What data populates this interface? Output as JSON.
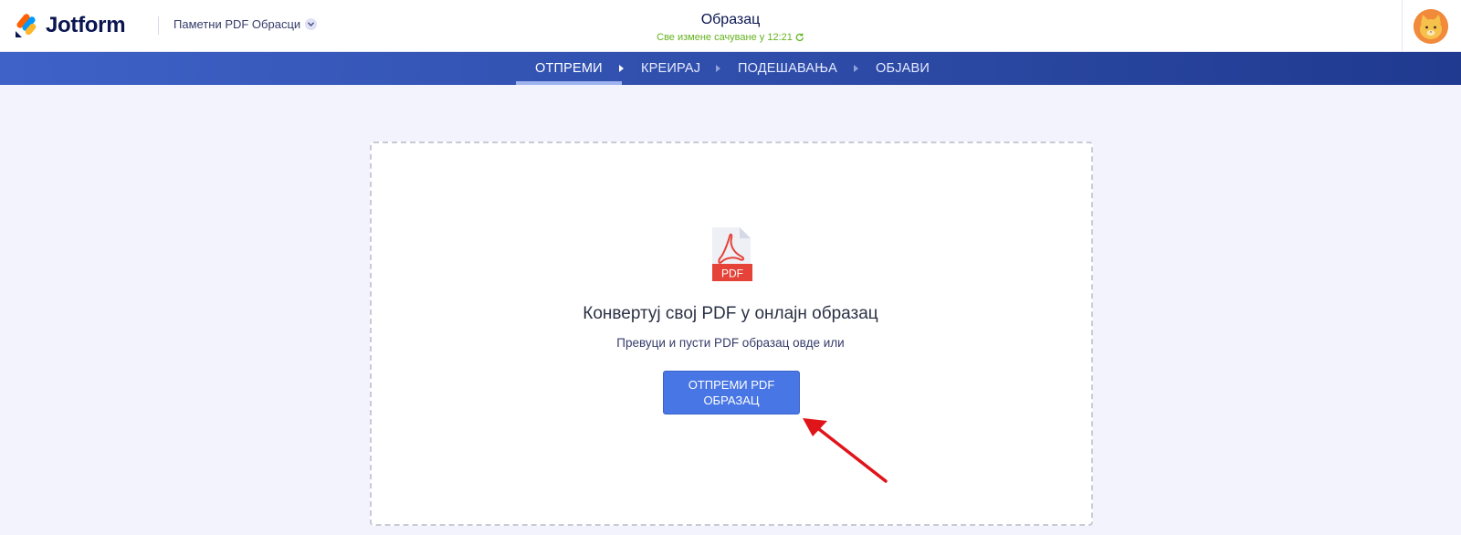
{
  "app": {
    "brand": "Jotform",
    "folder_label": "Паметни PDF Обрасци",
    "form_title": "Образац",
    "saved_status": "Све измене сачуване у 12:21"
  },
  "nav": {
    "steps": [
      {
        "label": "ОТПРЕМИ",
        "active": true
      },
      {
        "label": "КРЕИРАЈ",
        "active": false
      },
      {
        "label": "ПОДЕШАВАЊА",
        "active": false
      },
      {
        "label": "ОБЈАВИ",
        "active": false
      }
    ]
  },
  "upload": {
    "file_badge": "PDF",
    "heading": "Конвертуј свој PDF у онлајн образац",
    "subtext": "Превуци и пусти PDF образац овде или",
    "button_line1": "ОТПРЕМИ PDF",
    "button_line2": "ОБРАЗАЦ"
  },
  "colors": {
    "brand_navy": "#0a1551",
    "saved_green": "#64b220",
    "nav_start": "#3e62c8",
    "nav_end": "#1f3a8f",
    "button_blue": "#4876e4",
    "pdf_red": "#e54339",
    "annotation_arrow": "#e0151a"
  },
  "icons": [
    "jotform-logo-icon",
    "chevron-down-icon",
    "refresh-icon",
    "avatar-icon",
    "pdf-file-icon",
    "annotation-arrow-icon"
  ]
}
